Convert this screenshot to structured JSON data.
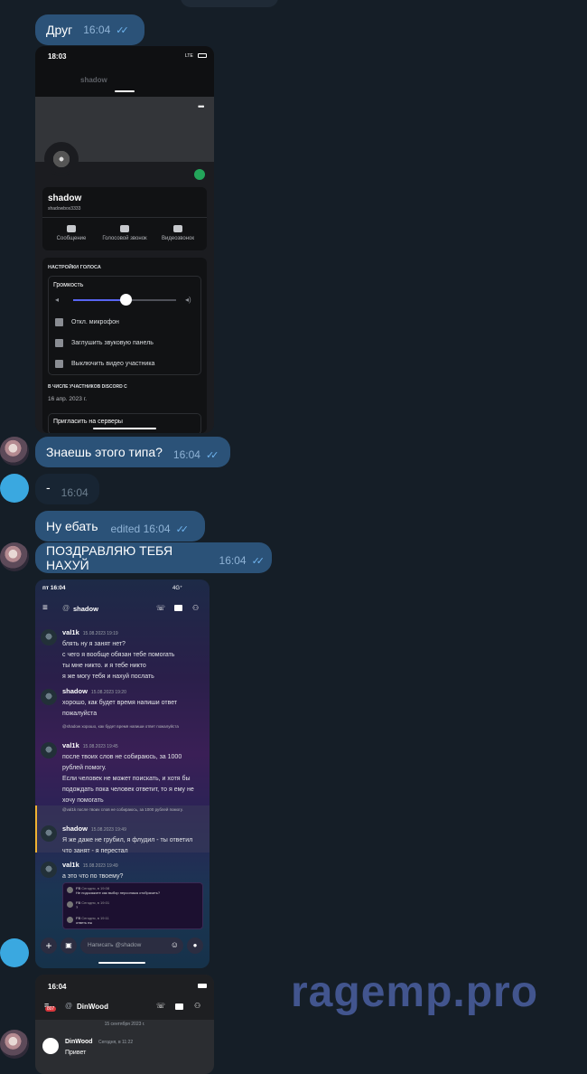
{
  "chat": {
    "top_pill": "",
    "messages": [
      {
        "text": "Друг",
        "time": "16:04"
      },
      {
        "text": "Знаешь этого типа?",
        "time": "16:04"
      },
      {
        "text": "-",
        "time": "16:04"
      },
      {
        "text": "Ну ебать",
        "edited": "edited",
        "time": "16:04"
      },
      {
        "text": "ПОЗДРАВЛЯЮ ТЕБЯ НАХУЙ",
        "time": "16:04"
      }
    ]
  },
  "shot1": {
    "status_time": "18:03",
    "status_right": "LTE",
    "header_name": "shadow",
    "username": "shadow",
    "handle": "shadowbox3333",
    "actions": [
      "Сообщение",
      "Голосовой звонок",
      "Видеозвонок"
    ],
    "voice_section": "НАСТРОЙКИ ГОЛОСА",
    "volume_label": "Громкость",
    "volume_fraction": 0.5,
    "rows": [
      "Откл. микрофон",
      "Заглушить звуковую панель",
      "Выключить видео участника"
    ],
    "member_since_label": "В ЧИСЛЕ УЧАСТНИКОВ DISCORD С",
    "member_since": "16 апр. 2023 г.",
    "invite": "Пригласить на серверы"
  },
  "shot2": {
    "status_time": "пт 16:04",
    "status_right": "4G⁺",
    "channel": "shadow",
    "messages": [
      {
        "author": "val1k",
        "date": "15.08.2023 19:19",
        "lines": [
          "блять ну я занят нет?",
          "с чего я вообще обязан тебе помогать",
          "ты мне никто. и я тебе никто",
          "я же могу тебя и нахуй послать"
        ]
      },
      {
        "author": "shadow",
        "date": "15.08.2023 19:20",
        "lines": [
          "хорошо, как будет время напиши ответ",
          "пожалуйста"
        ]
      },
      {
        "reply": "@shadow хорошо, как будет время напиши ответ пожалуйста",
        "author": "val1k",
        "date": "15.08.2023 19:45",
        "lines": [
          "после твоих слов не собираюсь, за 1000",
          "рублей помогу.",
          "Если человек не может поискать, и хотя бы",
          "подождать пока человек ответит, то я ему не",
          "хочу помогать"
        ]
      },
      {
        "reply": "@val1k после твоих слов не собираюсь, за 1000 рублей помогу.",
        "author": "shadow",
        "date": "15.08.2023 19:49",
        "lines": [
          "Я же даже не грубил, я флудил - ты ответил",
          "что занят - я перестал"
        ]
      },
      {
        "author": "val1k",
        "date": "15.08.2023 19:49",
        "lines": [
          "а это что по твоему?"
        ]
      }
    ],
    "embed": [
      {
        "name": "FB",
        "date": "Сегодня, в 19:08",
        "text": "Не подскажите как выбор персонажа отобразить?"
      },
      {
        "name": "FB",
        "date": "Сегодня, в 19:01",
        "text": "?"
      },
      {
        "name": "FB",
        "date": "Сегодня, в 19:11",
        "text": "ответь пж"
      }
    ],
    "input_placeholder": "Написать @shadow"
  },
  "shot3": {
    "status_time": "16:04",
    "badge": "807",
    "channel": "DinWood",
    "date_divider": "15 сентября 2023 г.",
    "author": "DinWood",
    "date": "Сегодня, в 11:22",
    "text": "Привет"
  },
  "watermark": "ragemp.pro"
}
